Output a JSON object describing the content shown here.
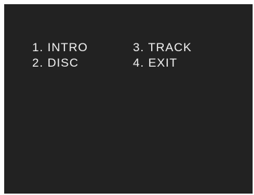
{
  "menu": {
    "items": [
      {
        "label": "1. INTRO"
      },
      {
        "label": "3. TRACK"
      },
      {
        "label": "2. DISC"
      },
      {
        "label": "4. EXIT"
      }
    ]
  },
  "colors": {
    "screen_background": "#222222",
    "text": "#f2f2f2",
    "border": "#ffffff"
  }
}
